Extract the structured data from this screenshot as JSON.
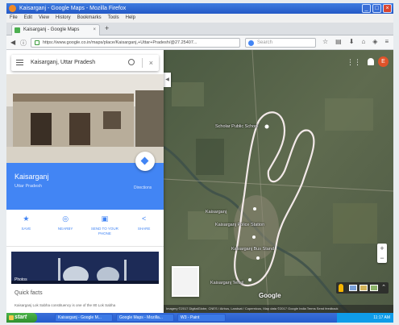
{
  "window": {
    "title": "Kaisarganj - Google Maps - Mozilla Firefox"
  },
  "menu": [
    "File",
    "Edit",
    "View",
    "History",
    "Bookmarks",
    "Tools",
    "Help"
  ],
  "tab": {
    "title": "Kaisarganj - Google Maps",
    "close": "×",
    "new": "+"
  },
  "nav": {
    "url": "https://www.google.co.in/maps/place/Kaisarganj,+Uttar+Pradesh/@27.25407...",
    "search_placeholder": "Search"
  },
  "panel": {
    "search_value": "Kaisarganj, Uttar Pradesh",
    "place_name": "Kaisarganj",
    "place_sub": "Uttar Pradesh",
    "directions_label": "Directions",
    "actions": [
      {
        "icon": "star-icon",
        "glyph": "★",
        "label": "SAVE"
      },
      {
        "icon": "nearby-icon",
        "glyph": "◎",
        "label": "NEARBY"
      },
      {
        "icon": "phone-icon",
        "glyph": "▣",
        "label": "SEND TO YOUR PHONE"
      },
      {
        "icon": "share-icon",
        "glyph": "<",
        "label": "SHARE"
      }
    ],
    "photos_label": "Photos",
    "quickfacts_heading": "Quick facts",
    "quickfacts_text": "Kaisarganj Lok Sabha constituency is one of the 80 Lok Sabha"
  },
  "map": {
    "labels": [
      {
        "text": "Scholar Public School",
        "pos": "upper"
      },
      {
        "text": "Kaisarganj",
        "pos": "middle-left"
      },
      {
        "text": "Kaisarganj Police Station",
        "pos": "middle"
      },
      {
        "text": "Kaisarganj Bus Stand",
        "pos": "lower"
      },
      {
        "text": "Kaisarganj Tehsil",
        "pos": "bottom"
      }
    ],
    "logo_text": "Google",
    "attribution": "Imagery ©2017 DigitalGlobe, CNES / Airbus, Landsat / Copernicus, Map data ©2017 Google  India  Terms  Send feedback",
    "avatar_letter": "E",
    "zoom_in": "+",
    "zoom_out": "−"
  },
  "taskbar": {
    "start": "start",
    "items": [
      "Kaisarganj - Google M...",
      "Google Maps - Mozilla...",
      "W3 - Paint"
    ],
    "clock": "11:17 AM"
  },
  "colors": {
    "accent": "#4285f4",
    "titlebar": "#2459c6",
    "taskbar": "#245ccd",
    "boundary": "#f3e9e9"
  }
}
